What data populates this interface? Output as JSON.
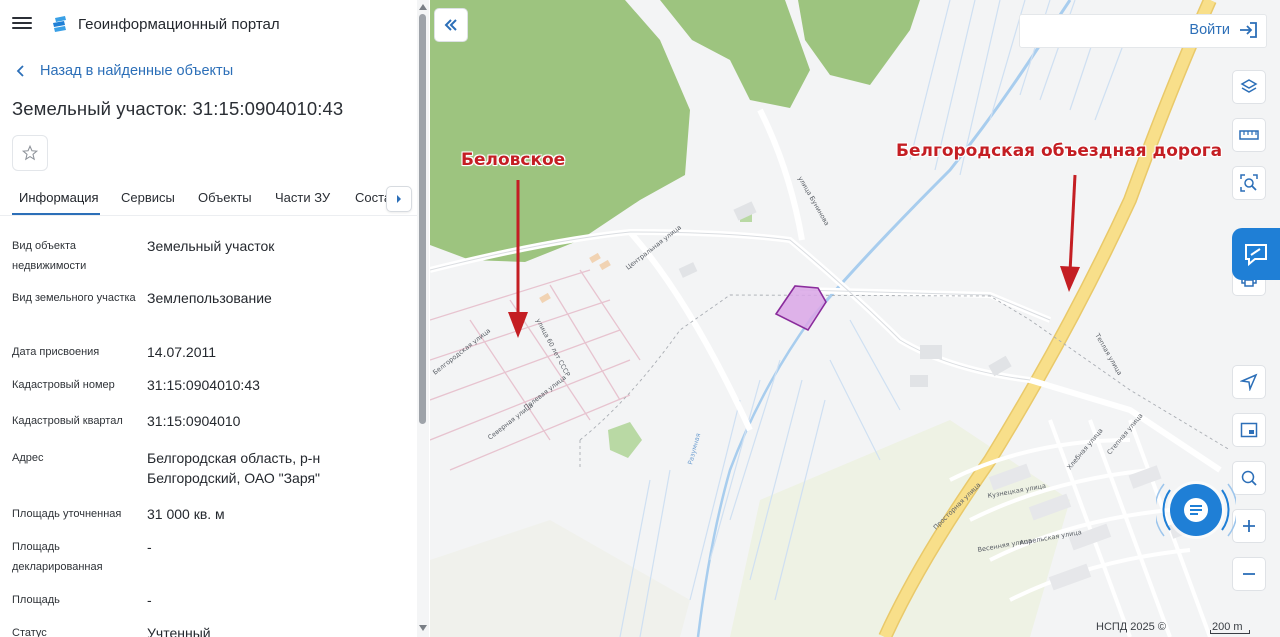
{
  "header": {
    "title": "Геоинформационный портал"
  },
  "back_link": {
    "label": "Назад в найденные объекты"
  },
  "object": {
    "title": "Земельный участок: 31:15:0904010:43"
  },
  "tabs": [
    {
      "label": "Информация"
    },
    {
      "label": "Сервисы"
    },
    {
      "label": "Объекты"
    },
    {
      "label": "Части ЗУ"
    },
    {
      "label": "Состав ЕЗП"
    }
  ],
  "properties": [
    {
      "key": "Вид объекта недвижимости",
      "value": "Земельный участок"
    },
    {
      "key": "Вид земельного участка",
      "value": "Землепользование"
    },
    {
      "key": "Дата присвоения",
      "value": "14.07.2011"
    },
    {
      "key": "Кадастровый номер",
      "value": "31:15:0904010:43"
    },
    {
      "key": "Кадастровый квартал",
      "value": "31:15:0904010"
    },
    {
      "key": "Адрес",
      "value": "Белгородская область, р-н Белгородский, ОАО \"Заря\""
    },
    {
      "key": "Площадь уточненная",
      "value": "31 000 кв. м"
    },
    {
      "key": "Площадь декларированная",
      "value": "-"
    },
    {
      "key": "Площадь",
      "value": "-"
    },
    {
      "key": "Статус",
      "value": "Учтенный"
    }
  ],
  "map": {
    "login_label": "Войти",
    "annotations": {
      "village": "Беловское",
      "road": "Белгородская объездная дорога"
    },
    "street_labels": {
      "central": "Центральная улица",
      "belgorod_st": "Белгородская улица",
      "polevaya": "Полевая улица",
      "severnaya": "Северная улица",
      "ussr": "улица 60 лет СССР",
      "bunina": "улица Бунинова",
      "teplaya": "Теплая улица",
      "prostornaya": "Просторная улица",
      "kuznetskaya": "Кузнецкая улица",
      "vesennyaya": "Весенняя улица",
      "aprelskaya": "Апрельская улица",
      "stepnaya": "Степная улица",
      "khlebnaya": "Хлебная улица",
      "razumnaya": "Разумная"
    },
    "copyright": "НСПД 2025 ©",
    "scale_label": "200 m"
  },
  "colors": {
    "accent": "#2c6fb8",
    "forest": "#9dc47f",
    "parcel_fill": "#d9a6e6",
    "parcel_stroke": "#8a2c9c",
    "road": "#f8df8a",
    "annotation": "#c41e23",
    "chat": "#1f7fd6"
  }
}
